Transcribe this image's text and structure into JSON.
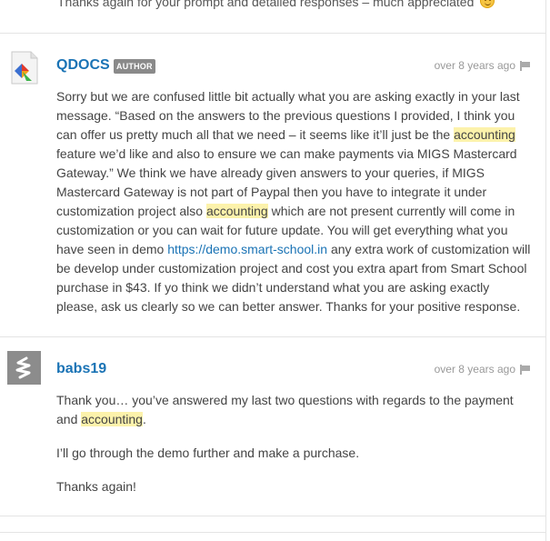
{
  "top_snippet": {
    "text": "Thanks again for your prompt and detailed responses – much appreciated"
  },
  "replies": [
    {
      "author": "QDOCS",
      "badge": "AUTHOR",
      "time": "over 8 years ago",
      "paragraphs": [
        {
          "parts": [
            {
              "text": "Sorry but we are confused little bit actually what you are asking exactly in your last message. “Based on the answers to the previous questions I provided, I think you can offer us pretty much all that we need – it seems like it’ll just be the "
            },
            {
              "text": "accounting",
              "type": "highlight"
            },
            {
              "text": " feature we’d like and also to ensure we can make payments via MIGS Mastercard Gateway.” We think we have already given answers to your queries, if MIGS Mastercard Gateway is not part of Paypal then you have to integrate it under customization project also "
            },
            {
              "text": "accounting",
              "type": "highlight"
            },
            {
              "text": " which are not present currently will come in customization or you can wait for future update. You will get everything what you have seen in demo "
            },
            {
              "text": "https://demo.smart-school.in",
              "type": "link"
            },
            {
              "text": " any extra work of customization will be develop under customization project and cost you extra apart from Smart School purchase in $43. If yo think we didn’t understand what you are asking exactly please, ask us clearly so we can better answer. Thanks for your positive response."
            }
          ]
        }
      ]
    },
    {
      "author": "babs19",
      "time": "over 8 years ago",
      "paragraphs": [
        {
          "parts": [
            {
              "text": "Thank you… you’ve answered my last two questions with regards to the payment and "
            },
            {
              "text": "accounting",
              "type": "highlight"
            },
            {
              "text": "."
            }
          ]
        },
        {
          "parts": [
            {
              "text": "I’ll go through the demo further and make a purchase."
            }
          ]
        },
        {
          "parts": [
            {
              "text": "Thanks again!"
            }
          ]
        }
      ]
    }
  ]
}
